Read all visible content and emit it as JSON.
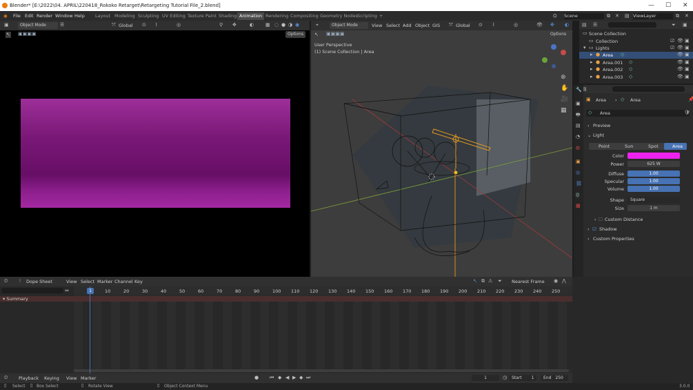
{
  "window": {
    "title": "Blender* [E:\\2022\\04. APRIL\\220418_Rokoko Retarget\\Retargeting Tutorial File_2.blend]",
    "min": "—",
    "max": "☐",
    "close": "✕"
  },
  "menu": [
    "File",
    "Edit",
    "Render",
    "Window",
    "Help"
  ],
  "workspaces": [
    "Layout",
    "Modeling",
    "Sculpting",
    "UV Editing",
    "Texture Paint",
    "Shading",
    "Animation",
    "Rendering",
    "Compositing",
    "Geometry Nodes",
    "Scripting",
    "+"
  ],
  "scene": {
    "name": "Scene",
    "view_layer": "ViewLayer"
  },
  "left_view": {
    "mode": "Object Mode",
    "orientation": "Global",
    "options": "Options"
  },
  "right_view": {
    "mode": "Object Mode",
    "menus": [
      "View",
      "Select",
      "Add",
      "Object",
      "GIS"
    ],
    "orientation": "Global",
    "options": "Options",
    "perspective": "User Perspective",
    "collection": "(1) Scene Collection | Area"
  },
  "outliner": {
    "items": [
      {
        "label": "Scene Collection"
      },
      {
        "label": "Collection"
      },
      {
        "label": "Lights"
      },
      {
        "label": "Area"
      },
      {
        "label": "Area.001"
      },
      {
        "label": "Area.002"
      },
      {
        "label": "Area.003"
      }
    ]
  },
  "properties": {
    "breadcrumb": [
      "Area",
      "Area"
    ],
    "datablock": "Area",
    "preview": "Preview",
    "light": "Light",
    "types": [
      "Point",
      "Sun",
      "Spot",
      "Area"
    ],
    "color_label": "Color",
    "color": "#ee22ee",
    "power_label": "Power",
    "power": "625 W",
    "diffuse_label": "Diffuse",
    "diffuse": "1.00",
    "specular_label": "Specular",
    "specular": "1.00",
    "volume_label": "Volume",
    "volume": "1.00",
    "shape_label": "Shape",
    "shape": "Square",
    "size_label": "Size",
    "size": "1 m",
    "custom_distance": "Custom Distance",
    "shadow": "Shadow",
    "custom_properties": "Custom Properties"
  },
  "dope": {
    "editor": "Dope Sheet",
    "menus": [
      "View",
      "Select",
      "Marker",
      "Channel",
      "Key"
    ],
    "snap": "Nearest Frame",
    "summary": "Summary",
    "current_frame": "1",
    "ticks": [
      "10",
      "20",
      "30",
      "40",
      "50",
      "60",
      "70",
      "80",
      "90",
      "100",
      "110",
      "120",
      "130",
      "140",
      "150",
      "160",
      "170",
      "180",
      "190",
      "200",
      "210",
      "220",
      "230",
      "240",
      "250"
    ]
  },
  "timeline": {
    "menus": [
      "Playback",
      "Keying",
      "View",
      "Marker"
    ],
    "frame": "1",
    "start_label": "Start",
    "start": "1",
    "end_label": "End",
    "end": "250"
  },
  "status": {
    "select": "Select",
    "box": "Box Select",
    "rotate": "Rotate View",
    "context": "Object Context Menu",
    "version": "3.0.0"
  }
}
